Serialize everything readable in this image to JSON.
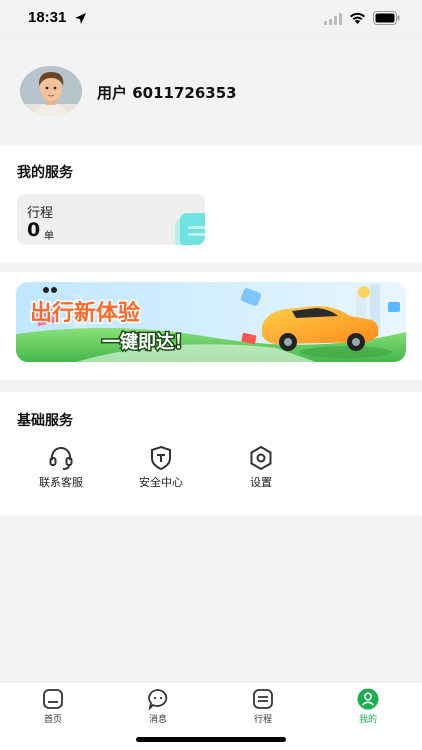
{
  "status_bar": {
    "time": "18:31"
  },
  "profile": {
    "username": "用户 6011726353"
  },
  "my_services": {
    "title": "我的服务",
    "trip_label": "行程",
    "trip_count": "0",
    "trip_unit": "单"
  },
  "banner": {
    "headline": "出行新体验",
    "subline": "一键即达！"
  },
  "basic_services": {
    "title": "基础服务",
    "items": [
      {
        "label": "联系客服",
        "icon": "headset-icon"
      },
      {
        "label": "安全中心",
        "icon": "shield-icon"
      },
      {
        "label": "设置",
        "icon": "settings-icon"
      }
    ]
  },
  "tab_bar": {
    "tabs": [
      {
        "label": "首页",
        "icon": "home-icon"
      },
      {
        "label": "消息",
        "icon": "message-icon"
      },
      {
        "label": "行程",
        "icon": "trip-list-icon"
      },
      {
        "label": "我的",
        "icon": "profile-icon",
        "active": true
      }
    ]
  },
  "colors": {
    "accent": "#1aae4e",
    "background": "#f3f3f3",
    "trip_icon": "#6fe3e0"
  }
}
